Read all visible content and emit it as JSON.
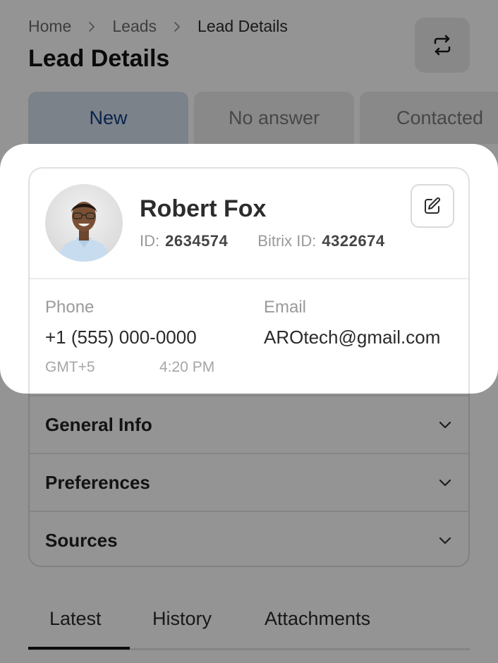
{
  "breadcrumb": {
    "items": [
      "Home",
      "Leads",
      "Lead Details"
    ]
  },
  "page": {
    "title": "Lead Details"
  },
  "status_tabs": [
    {
      "label": "New",
      "active": true
    },
    {
      "label": "No answer",
      "active": false
    },
    {
      "label": "Contacted",
      "active": false
    }
  ],
  "lead": {
    "name": "Robert Fox",
    "id_label": "ID:",
    "id_value": "2634574",
    "bitrix_label": "Bitrix ID:",
    "bitrix_value": "4322674",
    "phone_label": "Phone",
    "phone_value": "+1 (555) 000-0000",
    "email_label": "Email",
    "email_value": "AROtech@gmail.com",
    "timezone": "GMT+5",
    "local_time": "4:20 PM"
  },
  "sections": [
    {
      "label": "General Info"
    },
    {
      "label": "Preferences"
    },
    {
      "label": "Sources"
    }
  ],
  "bottom_tabs": [
    {
      "label": "Latest",
      "active": true
    },
    {
      "label": "History",
      "active": false
    },
    {
      "label": "Attachments",
      "active": false
    }
  ],
  "colors": {
    "accent": "#0f3e82",
    "active_tab_bg": "#d6e0ec",
    "scrim": "rgba(0,0,0,0.42)"
  }
}
